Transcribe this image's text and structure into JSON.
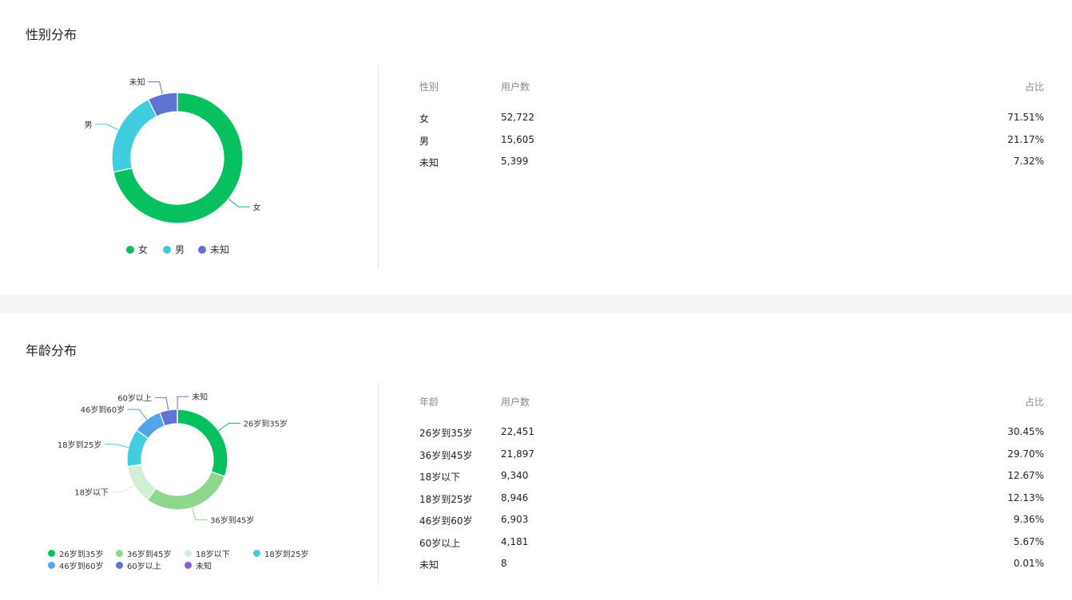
{
  "gender": {
    "title": "性别分布",
    "table": {
      "headers": [
        "性别",
        "用户数",
        "占比"
      ],
      "rows": [
        [
          "女",
          "52,722",
          "71.51%"
        ],
        [
          "男",
          "15,605",
          "21.17%"
        ],
        [
          "未知",
          "5,399",
          "7.32%"
        ]
      ]
    }
  },
  "age": {
    "title": "年龄分布",
    "table": {
      "headers": [
        "年龄",
        "用户数",
        "占比"
      ],
      "rows": [
        [
          "26岁到35岁",
          "22,451",
          "30.45%"
        ],
        [
          "36岁到45岁",
          "21,897",
          "29.70%"
        ],
        [
          "18岁以下",
          "9,340",
          "12.67%"
        ],
        [
          "18岁到25岁",
          "8,946",
          "12.13%"
        ],
        [
          "46岁到60岁",
          "6,903",
          "9.36%"
        ],
        [
          "60岁以上",
          "4,181",
          "5.67%"
        ],
        [
          "未知",
          "8",
          "0.01%"
        ]
      ]
    }
  },
  "chart_data": [
    {
      "type": "pie",
      "title": "性别分布",
      "categories": [
        "女",
        "男",
        "未知"
      ],
      "values": [
        52722,
        15605,
        5399
      ],
      "colors": [
        "#07c160",
        "#40cde0",
        "#6173d1"
      ],
      "legend": "bottom"
    },
    {
      "type": "pie",
      "title": "年龄分布",
      "categories": [
        "26岁到35岁",
        "36岁到45岁",
        "18岁以下",
        "18岁到25岁",
        "46岁到60岁",
        "60岁以上",
        "未知"
      ],
      "values": [
        22451,
        21897,
        9340,
        8946,
        6903,
        4181,
        8
      ],
      "colors": [
        "#07c160",
        "#8fd68f",
        "#d1efd4",
        "#40cde0",
        "#52a5ea",
        "#6173d1",
        "#8e5dd0"
      ],
      "legend": "bottom"
    }
  ]
}
